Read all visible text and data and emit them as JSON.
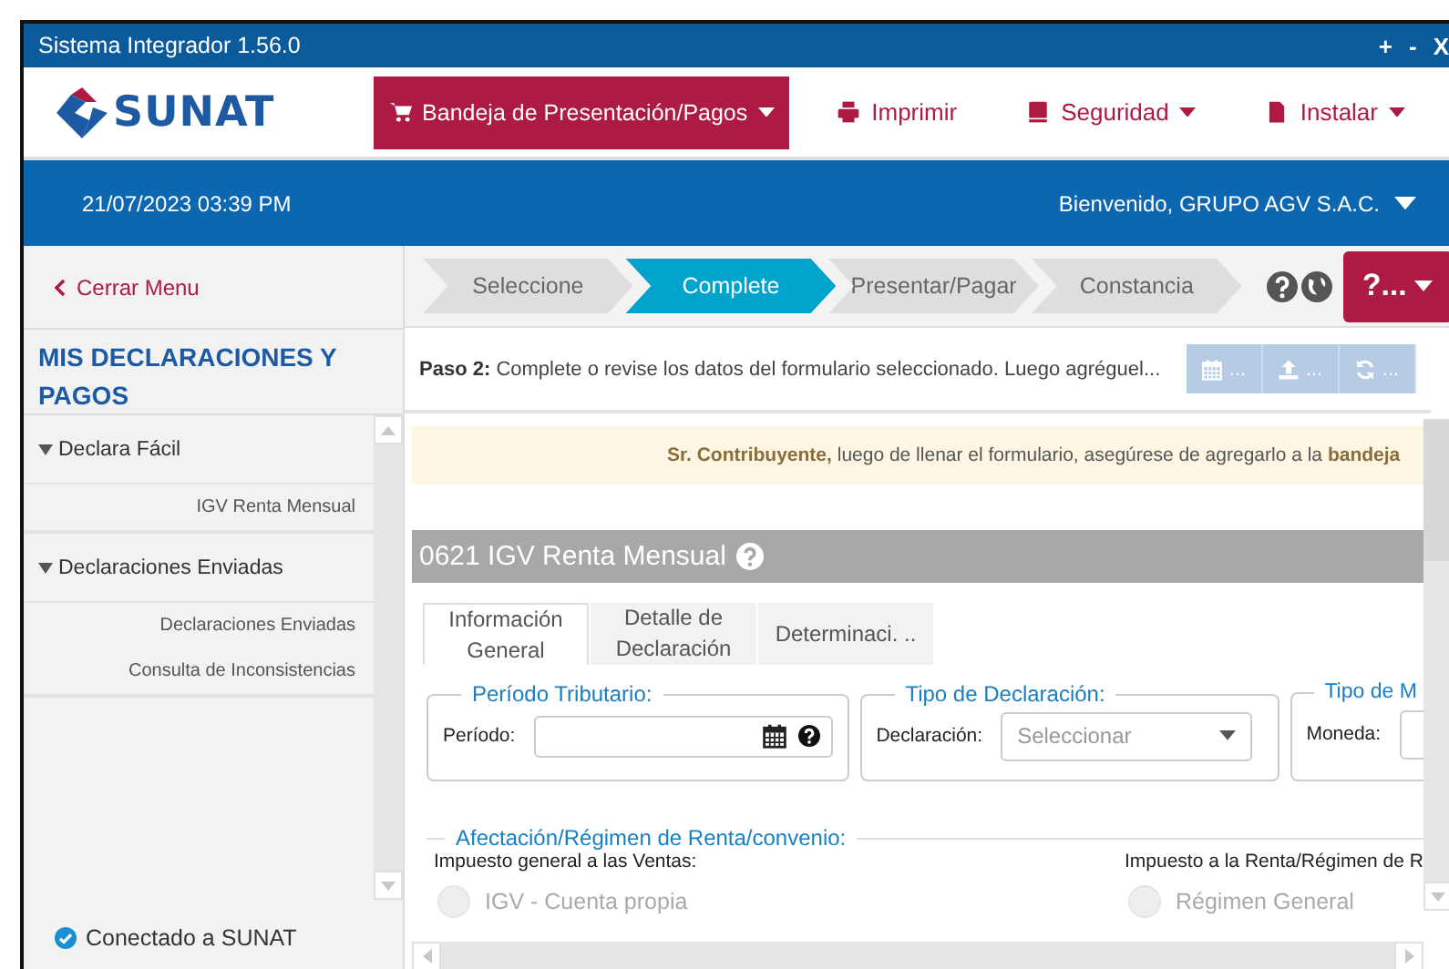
{
  "window": {
    "title": "Sistema Integrador 1.56.0",
    "controls": [
      "+",
      "-",
      "X"
    ]
  },
  "header": {
    "logo": "SUNAT",
    "menu": [
      {
        "label": "Bandeja de Presentación/Pagos",
        "dropdown": true,
        "selected": true
      },
      {
        "label": "Imprimir",
        "dropdown": false,
        "selected": false
      },
      {
        "label": "Seguridad",
        "dropdown": true,
        "selected": false
      },
      {
        "label": "Instalar",
        "dropdown": true,
        "selected": false
      }
    ]
  },
  "info_bar": {
    "datetime": "21/07/2023 03:39 PM",
    "welcome": "Bienvenido, GRUPO AGV S.A.C."
  },
  "sidebar": {
    "close": "Cerrar Menu",
    "title": "MIS DECLARACIONES Y PAGOS",
    "sections": [
      {
        "label": "Declara Fácil",
        "expanded": true,
        "items": [
          "IGV Renta Mensual"
        ]
      },
      {
        "label": "Declaraciones Enviadas",
        "expanded": true,
        "items": [
          "Declaraciones Enviadas",
          "Consulta de Inconsistencias"
        ]
      }
    ],
    "status": "Conectado a SUNAT"
  },
  "steps": [
    {
      "label": "Seleccione",
      "selected": false
    },
    {
      "label": "Complete",
      "selected": true
    },
    {
      "label": "Presentar/Pagar",
      "selected": false
    },
    {
      "label": "Constancia",
      "selected": false
    }
  ],
  "help_button": "?...",
  "step_bar": {
    "step": "Paso 2:",
    "text": "Complete o revise los datos del formulario seleccionado. Luego agréguel...",
    "buttons": [
      {
        "label": "...",
        "disabled": true
      },
      {
        "label": "...",
        "disabled": true
      },
      {
        "label": "...",
        "disabled": true
      }
    ]
  },
  "notice": "**Sr. Contribuyente,** luego de llenar el formulario, asegúrese de agregarlo a la **bandeja**",
  "form": {
    "title": "0621 IGV Renta Mensual",
    "tabs": [
      {
        "label": "Información General",
        "selected": true
      },
      {
        "label": "Detalle de Declaración",
        "selected": false
      },
      {
        "label": "Determinaci. ..",
        "selected": false
      }
    ],
    "groups": [
      {
        "legend": "Período Tributario:",
        "label": "Período:",
        "kind": "date"
      },
      {
        "legend": "Tipo de Declaración:",
        "label": "Declaración:",
        "kind": "select",
        "placeholder": "Seleccionar"
      },
      {
        "legend": "Tipo de M",
        "label": "Moneda:",
        "kind": "select"
      }
    ],
    "regime": {
      "legend": "Afectación/Régimen de Renta/convenio:",
      "columns": [
        {
          "label": "Impuesto general a las Ventas:",
          "option": "IGV - Cuenta propia",
          "disabled": true
        },
        {
          "label": "Impuesto a la Renta/Régimen de R",
          "option": "Régimen General",
          "disabled": true
        }
      ]
    }
  }
}
